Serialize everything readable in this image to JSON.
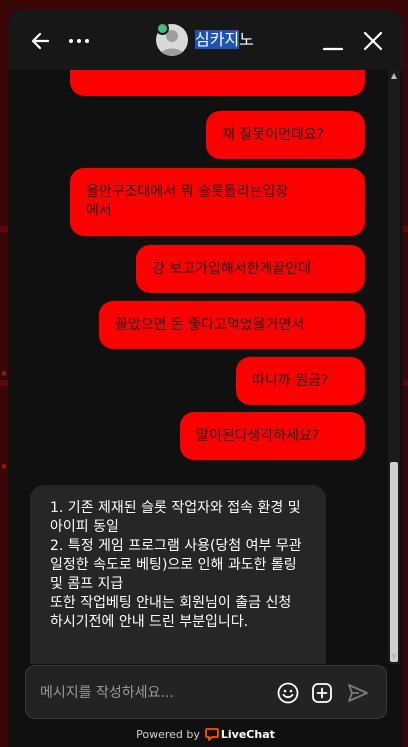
{
  "header": {
    "agent_name_highlight": "심카지",
    "agent_name_rest": "노"
  },
  "messages": {
    "visitor": [
      "재 잘못이먼데요?",
      "올안구조대에서 뭐 슬롯돌리는입장\n에서",
      "걍 보고가입해서한게끝인데",
      "꼴았으면 돈 좋다고먹었을거면서",
      "따니까 원금?",
      "말이된다생각하세요?"
    ],
    "agent": "1. 기존 제재된 슬롯 작업자와 접속 환경 및 아이피 동일\n2. 특정 게임 프로그램 사용(당첨 여부 무관일정한 속도로 베팅)으로 인해 과도한 롤링 및 콤프 지급\n또한 작업베팅 안내는 회원님이 출금 신청 하시기전에 안내 드린 부분입니다."
  },
  "composer": {
    "placeholder": "메시지를 작성하세요..."
  },
  "footer": {
    "powered_by": "Powered by",
    "brand": "LiveChat"
  },
  "colors": {
    "visitor_bubble": "#ff0000",
    "agent_bubble": "#262626",
    "widget_bg": "#101010",
    "brand_accent": "#ff5100"
  },
  "icons": [
    "back-arrow-icon",
    "more-dots-icon",
    "minimize-icon",
    "close-icon",
    "emoji-icon",
    "attach-plus-icon",
    "send-icon",
    "livechat-logo-icon"
  ]
}
